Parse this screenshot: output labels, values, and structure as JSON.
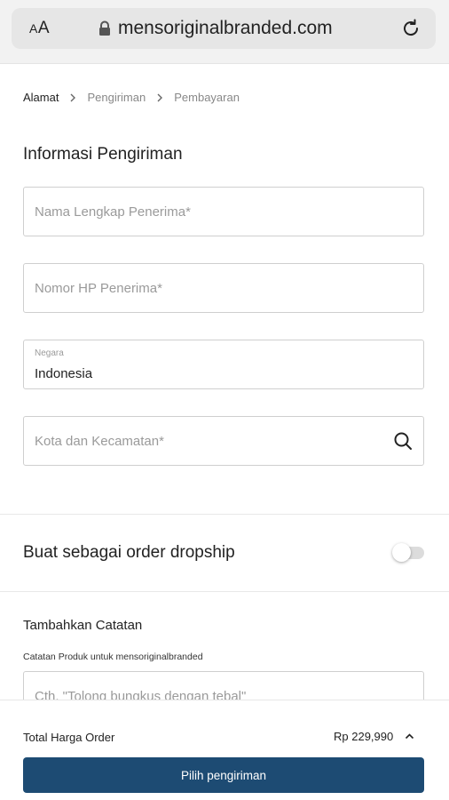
{
  "browser": {
    "aa_label": "AA",
    "url": "mensoriginalbranded.com"
  },
  "breadcrumb": [
    "Alamat",
    "Pengiriman",
    "Pembayaran"
  ],
  "shipping_info": {
    "title": "Informasi Pengiriman",
    "name_placeholder": "Nama Lengkap Penerima*",
    "phone_placeholder": "Nomor HP Penerima*",
    "country_label": "Negara",
    "country_value": "Indonesia",
    "city_placeholder": "Kota dan Kecamatan*"
  },
  "dropship": {
    "label": "Buat sebagai order dropship",
    "enabled": false
  },
  "notes": {
    "title": "Tambahkan Catatan",
    "subtitle": "Catatan Produk untuk mensoriginalbranded",
    "placeholder": "Cth. \"Tolong bungkus dengan tebal\""
  },
  "footer": {
    "total_label": "Total Harga Order",
    "total_value": "Rp 229,990",
    "cta_label": "Pilih pengiriman"
  },
  "colors": {
    "primary": "#1d4b73",
    "border": "#cfcfcf",
    "placeholder": "#9a9a9a"
  }
}
